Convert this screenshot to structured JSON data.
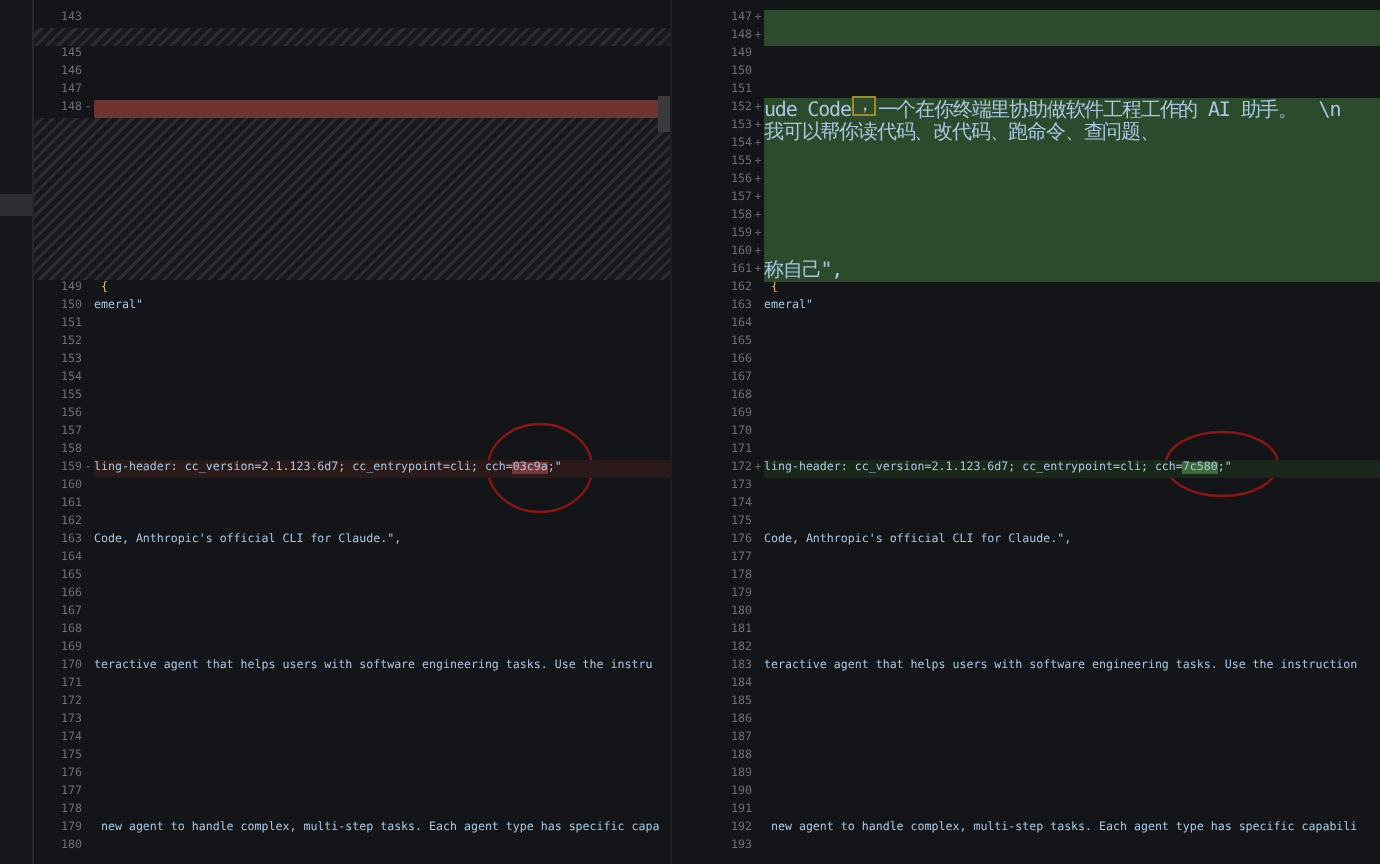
{
  "sidebar": {
    "items": [
      {
        "selected": true
      }
    ]
  },
  "panes": [
    {
      "rows": [
        {
          "num": "143",
          "kind": "context"
        },
        {
          "kind": "filler"
        },
        {
          "num": "145",
          "kind": "context"
        },
        {
          "num": "146",
          "kind": "context"
        },
        {
          "num": "147",
          "kind": "context"
        },
        {
          "num": "148",
          "kind": "deleted",
          "marker": "-"
        },
        {
          "kind": "filler"
        },
        {
          "kind": "filler"
        },
        {
          "kind": "filler"
        },
        {
          "kind": "filler"
        },
        {
          "kind": "filler"
        },
        {
          "kind": "filler"
        },
        {
          "kind": "filler"
        },
        {
          "kind": "filler"
        },
        {
          "kind": "filler"
        },
        {
          "num": "149",
          "kind": "context",
          "segments": [
            {
              "text": " {",
              "kind": "punct"
            }
          ]
        },
        {
          "num": "150",
          "kind": "context",
          "segments": [
            {
              "text": "emeral\"",
              "kind": "text"
            }
          ]
        },
        {
          "num": "151",
          "kind": "context"
        },
        {
          "num": "152",
          "kind": "context"
        },
        {
          "num": "153",
          "kind": "context"
        },
        {
          "num": "154",
          "kind": "context"
        },
        {
          "num": "155",
          "kind": "context"
        },
        {
          "num": "156",
          "kind": "context"
        },
        {
          "num": "157",
          "kind": "context"
        },
        {
          "num": "158",
          "kind": "context"
        },
        {
          "num": "159",
          "kind": "modified",
          "marker": "-",
          "segments": [
            {
              "text": "ling-header: cc_version=2.1.123.6d7; cc_entrypoint=cli; cch=",
              "kind": "text"
            },
            {
              "text": "03c9a",
              "kind": "changed"
            },
            {
              "text": ";\"",
              "kind": "text"
            }
          ]
        },
        {
          "num": "160",
          "kind": "context"
        },
        {
          "num": "161",
          "kind": "context"
        },
        {
          "num": "162",
          "kind": "context"
        },
        {
          "num": "163",
          "kind": "context",
          "segments": [
            {
              "text": "Code, Anthropic's official CLI for Claude.\",",
              "kind": "text"
            }
          ]
        },
        {
          "num": "164",
          "kind": "context"
        },
        {
          "num": "165",
          "kind": "context"
        },
        {
          "num": "166",
          "kind": "context"
        },
        {
          "num": "167",
          "kind": "context"
        },
        {
          "num": "168",
          "kind": "context"
        },
        {
          "num": "169",
          "kind": "context"
        },
        {
          "num": "170",
          "kind": "context",
          "segments": [
            {
              "text": "teractive agent that helps users with software engineering tasks. Use the instru",
              "kind": "text"
            }
          ]
        },
        {
          "num": "171",
          "kind": "context"
        },
        {
          "num": "172",
          "kind": "context"
        },
        {
          "num": "173",
          "kind": "context"
        },
        {
          "num": "174",
          "kind": "context"
        },
        {
          "num": "175",
          "kind": "context"
        },
        {
          "num": "176",
          "kind": "context"
        },
        {
          "num": "177",
          "kind": "context"
        },
        {
          "num": "178",
          "kind": "context"
        },
        {
          "num": "179",
          "kind": "context",
          "segments": [
            {
              "text": " new agent to handle complex, multi-step tasks. Each agent type has specific capa",
              "kind": "text"
            }
          ]
        },
        {
          "num": "180",
          "kind": "context"
        }
      ]
    },
    {
      "rows": [
        {
          "num": "147",
          "kind": "inserted",
          "marker": "+"
        },
        {
          "num": "148",
          "kind": "inserted",
          "marker": "+"
        },
        {
          "num": "149",
          "kind": "context"
        },
        {
          "num": "150",
          "kind": "context"
        },
        {
          "num": "151",
          "kind": "context"
        },
        {
          "num": "152",
          "kind": "inserted",
          "marker": "+",
          "segments": [
            {
              "text": "ude Code",
              "kind": "text"
            },
            {
              "text": "，",
              "kind": "cursor"
            },
            {
              "text": "一个在你终端里协助做软件工程工作的 AI 助手。  \\n",
              "kind": "text"
            },
            {
              "text": "我可以帮你读代码、改代码、跑命令、查问题、",
              "kind": "text"
            }
          ]
        },
        {
          "num": "153",
          "kind": "inserted",
          "marker": "+"
        },
        {
          "num": "154",
          "kind": "inserted",
          "marker": "+"
        },
        {
          "num": "155",
          "kind": "inserted",
          "marker": "+"
        },
        {
          "num": "156",
          "kind": "inserted",
          "marker": "+"
        },
        {
          "num": "157",
          "kind": "inserted",
          "marker": "+"
        },
        {
          "num": "158",
          "kind": "inserted",
          "marker": "+"
        },
        {
          "num": "159",
          "kind": "inserted",
          "marker": "+"
        },
        {
          "num": "160",
          "kind": "inserted",
          "marker": "+"
        },
        {
          "num": "161",
          "kind": "inserted",
          "marker": "+",
          "segments": [
            {
              "text": "称自己\",",
              "kind": "text"
            }
          ]
        },
        {
          "num": "162",
          "kind": "context",
          "segments": [
            {
              "text": " {",
              "kind": "punct"
            }
          ]
        },
        {
          "num": "163",
          "kind": "context",
          "segments": [
            {
              "text": "emeral\"",
              "kind": "text"
            }
          ]
        },
        {
          "num": "164",
          "kind": "context"
        },
        {
          "num": "165",
          "kind": "context"
        },
        {
          "num": "166",
          "kind": "context"
        },
        {
          "num": "167",
          "kind": "context"
        },
        {
          "num": "168",
          "kind": "context"
        },
        {
          "num": "169",
          "kind": "context"
        },
        {
          "num": "170",
          "kind": "context"
        },
        {
          "num": "171",
          "kind": "context"
        },
        {
          "num": "172",
          "kind": "modified",
          "marker": "+",
          "segments": [
            {
              "text": "ling-header: cc_version=2.1.123.6d7; cc_entrypoint=cli; cch=",
              "kind": "text"
            },
            {
              "text": "7c580",
              "kind": "changed"
            },
            {
              "text": ";\"",
              "kind": "text"
            }
          ]
        },
        {
          "num": "173",
          "kind": "context"
        },
        {
          "num": "174",
          "kind": "context"
        },
        {
          "num": "175",
          "kind": "context"
        },
        {
          "num": "176",
          "kind": "context",
          "segments": [
            {
              "text": "Code, Anthropic's official CLI for Claude.\",",
              "kind": "text"
            }
          ]
        },
        {
          "num": "177",
          "kind": "context"
        },
        {
          "num": "178",
          "kind": "context"
        },
        {
          "num": "179",
          "kind": "context"
        },
        {
          "num": "180",
          "kind": "context"
        },
        {
          "num": "181",
          "kind": "context"
        },
        {
          "num": "182",
          "kind": "context"
        },
        {
          "num": "183",
          "kind": "context",
          "segments": [
            {
              "text": "teractive agent that helps users with software engineering tasks. Use the instruction",
              "kind": "text"
            }
          ]
        },
        {
          "num": "184",
          "kind": "context"
        },
        {
          "num": "185",
          "kind": "context"
        },
        {
          "num": "186",
          "kind": "context"
        },
        {
          "num": "187",
          "kind": "context"
        },
        {
          "num": "188",
          "kind": "context"
        },
        {
          "num": "189",
          "kind": "context"
        },
        {
          "num": "190",
          "kind": "context"
        },
        {
          "num": "191",
          "kind": "context"
        },
        {
          "num": "192",
          "kind": "context",
          "segments": [
            {
              "text": " new agent to handle complex, multi-step tasks. Each agent type has specific capabili",
              "kind": "text"
            }
          ]
        },
        {
          "num": "193",
          "kind": "context"
        }
      ]
    }
  ]
}
